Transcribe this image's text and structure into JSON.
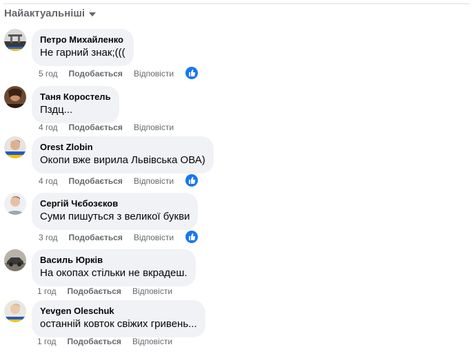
{
  "sort": {
    "label": "Найактуальніші"
  },
  "labels": {
    "like": "Подобається",
    "reply": "Відповісти"
  },
  "comments": [
    {
      "author": "Петро Михайленко",
      "text": "Не гарний знак;(((",
      "time": "5 год",
      "has_reaction": true
    },
    {
      "author": "Таня Коростель",
      "text": "Пздц...",
      "time": "4 год",
      "has_reaction": false
    },
    {
      "author": "Orest Zlobin",
      "text": "Окопи вже вирила Львівська ОВА)",
      "time": "4 год",
      "has_reaction": true
    },
    {
      "author": "Сергій Чєбозєков",
      "text": "Суми пишуться з великої букви",
      "time": "3 год",
      "has_reaction": true
    },
    {
      "author": "Василь Юрків",
      "text": "На окопах стільки не вкрадеш.",
      "time": "1 год",
      "has_reaction": false
    },
    {
      "author": "Yevgen Oleschuk",
      "text": "останній ковток свіжих гривень...",
      "time": "1 год",
      "has_reaction": false
    }
  ],
  "colors": {
    "bubble": "#f0f2f5",
    "secondary_text": "#65676b",
    "reaction": "#1877f2"
  },
  "icons": {
    "sort": "chevron-down-icon",
    "reaction": "thumbs-up-icon"
  }
}
